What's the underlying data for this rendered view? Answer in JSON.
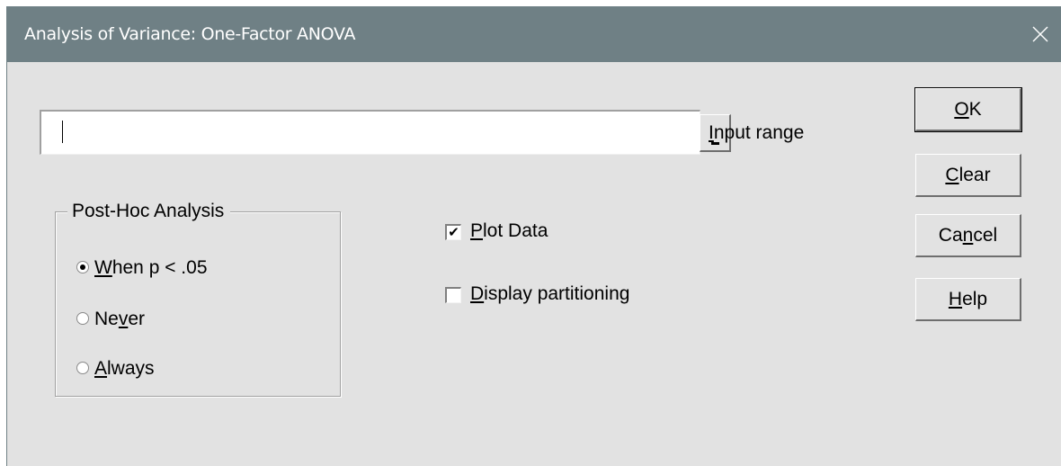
{
  "window": {
    "title": "Analysis of Variance: One-Factor ANOVA",
    "titlebar_color": "#6f8085",
    "background_color": "#e2e2e2"
  },
  "input_range": {
    "value": "",
    "label_mnemonic": "I",
    "label_rest": "nput range"
  },
  "post_hoc": {
    "legend": "Post-Hoc Analysis",
    "options": [
      {
        "mnemonic": "W",
        "rest": "hen p  < .05",
        "selected": true
      },
      {
        "pre": "Ne",
        "mnemonic": "v",
        "rest": "er",
        "selected": false
      },
      {
        "mnemonic": "A",
        "rest": "lways",
        "selected": false
      }
    ]
  },
  "options": {
    "plot_data": {
      "mnemonic": "P",
      "rest": "lot Data",
      "checked": true,
      "check_glyph": "✔"
    },
    "display_partitioning": {
      "mnemonic": "D",
      "rest": "isplay partitioning",
      "checked": false
    }
  },
  "buttons": {
    "ok": {
      "mnemonic": "O",
      "rest": "K"
    },
    "clear": {
      "mnemonic": "C",
      "rest": "lear"
    },
    "cancel": {
      "pre": "Ca",
      "mnemonic": "n",
      "rest": "cel"
    },
    "help": {
      "mnemonic": "H",
      "rest": "elp"
    }
  },
  "icons": {
    "close": "close-icon"
  }
}
